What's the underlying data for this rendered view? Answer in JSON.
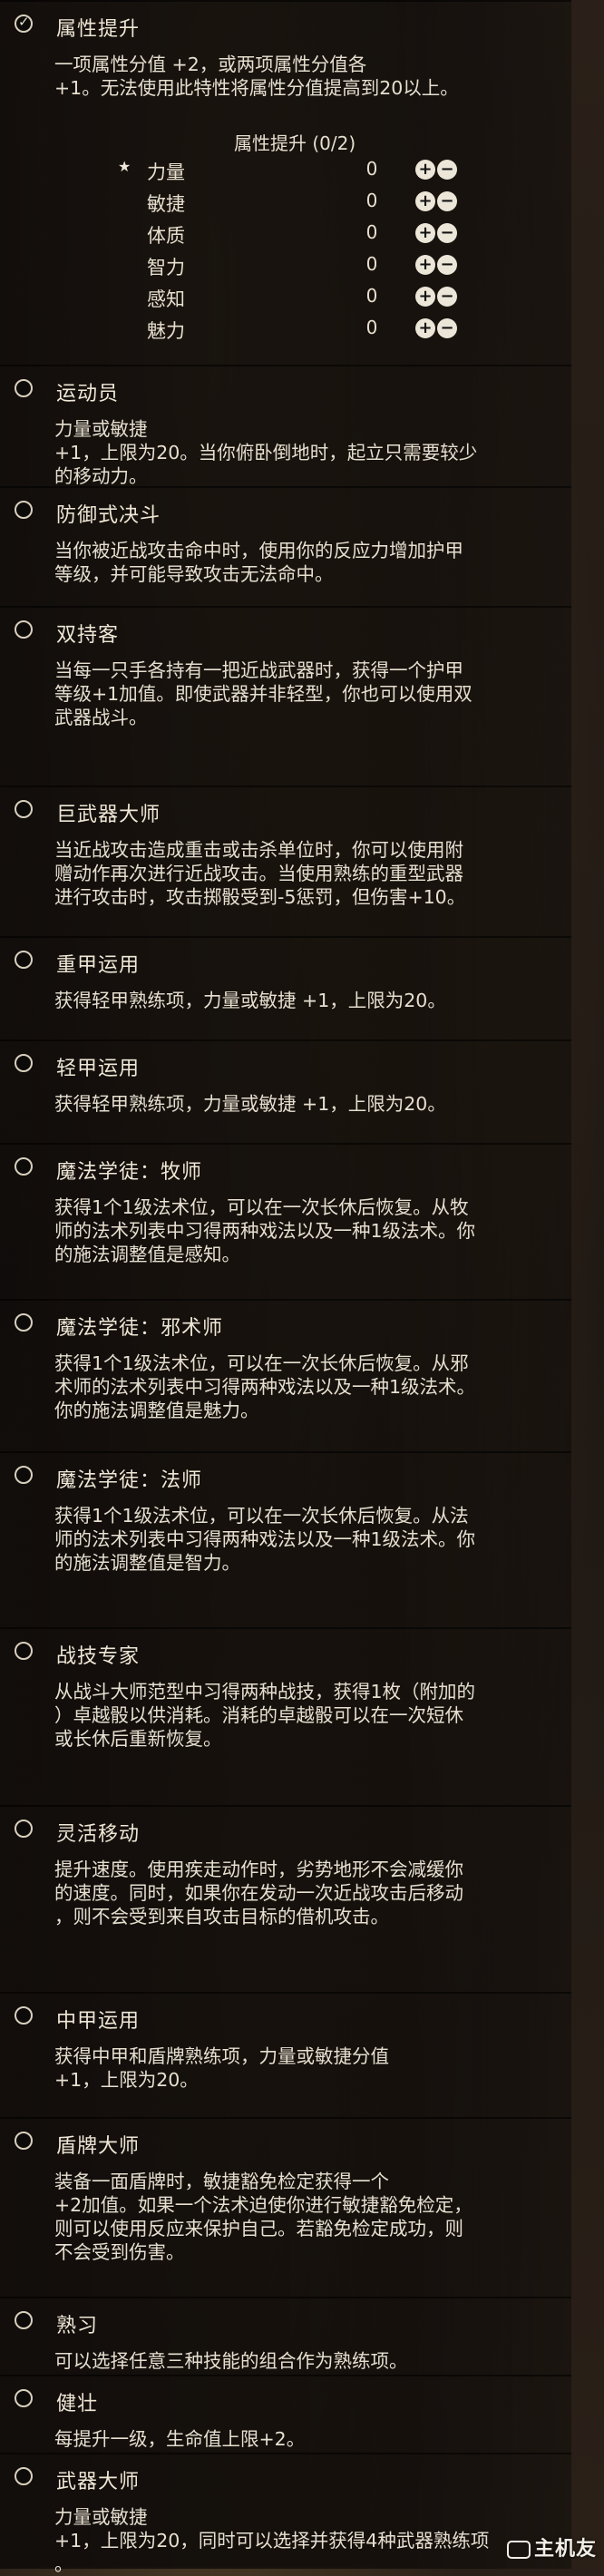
{
  "feats": [
    {
      "title": "属性提升",
      "checked": true,
      "desc": "一项属性分值 +2，或两项属性分值各\n+1。无法使用此特性将属性分值提高到20以上。"
    },
    {
      "title": "运动员",
      "checked": false,
      "desc": "力量或敏捷\n+1，上限为20。当你俯卧倒地时，起立只需要较少\n的移动力。"
    },
    {
      "title": "防御式决斗",
      "checked": false,
      "desc": "当你被近战攻击命中时，使用你的反应力增加护甲\n等级，并可能导致攻击无法命中。"
    },
    {
      "title": "双持客",
      "checked": false,
      "desc": "当每一只手各持有一把近战武器时，获得一个护甲\n等级+1加值。即使武器并非轻型，你也可以使用双\n武器战斗。"
    },
    {
      "title": "巨武器大师",
      "checked": false,
      "desc": "当近战攻击造成重击或击杀单位时，你可以使用附\n赠动作再次进行近战攻击。当使用熟练的重型武器\n进行攻击时，攻击掷骰受到-5惩罚，但伤害+10。"
    },
    {
      "title": "重甲运用",
      "checked": false,
      "desc": "获得轻甲熟练项，力量或敏捷 +1，上限为20。"
    },
    {
      "title": "轻甲运用",
      "checked": false,
      "desc": "获得轻甲熟练项，力量或敏捷 +1，上限为20。"
    },
    {
      "title": "魔法学徒：牧师",
      "checked": false,
      "desc": "获得1个1级法术位，可以在一次长休后恢复。从牧\n师的法术列表中习得两种戏法以及一种1级法术。你\n的施法调整值是感知。"
    },
    {
      "title": "魔法学徒：邪术师",
      "checked": false,
      "desc": "获得1个1级法术位，可以在一次长休后恢复。从邪\n术师的法术列表中习得两种戏法以及一种1级法术。\n你的施法调整值是魅力。"
    },
    {
      "title": "魔法学徒：法师",
      "checked": false,
      "desc": "获得1个1级法术位，可以在一次长休后恢复。从法\n师的法术列表中习得两种戏法以及一种1级法术。你\n的施法调整值是智力。"
    },
    {
      "title": "战技专家",
      "checked": false,
      "desc": "从战斗大师范型中习得两种战技，获得1枚（附加的\n）卓越骰以供消耗。消耗的卓越骰可以在一次短休\n或长休后重新恢复。"
    },
    {
      "title": "灵活移动",
      "checked": false,
      "desc": "提升速度。使用疾走动作时，劣势地形不会减缓你\n的速度。同时，如果你在发动一次近战攻击后移动\n，则不会受到来自攻击目标的借机攻击。"
    },
    {
      "title": "中甲运用",
      "checked": false,
      "desc": "获得中甲和盾牌熟练项，力量或敏捷分值\n+1，上限为20。"
    },
    {
      "title": "盾牌大师",
      "checked": false,
      "desc": "装备一面盾牌时，敏捷豁免检定获得一个\n+2加值。如果一个法术迫使你进行敏捷豁免检定，\n则可以使用反应来保护自己。若豁免检定成功，则\n不会受到伤害。"
    },
    {
      "title": "熟习",
      "checked": false,
      "desc": "可以选择任意三种技能的组合作为熟练项。"
    },
    {
      "title": "健壮",
      "checked": false,
      "desc": "每提升一级，生命值上限+2。"
    },
    {
      "title": "武器大师",
      "checked": false,
      "desc": "力量或敏捷\n+1，上限为20，同时可以选择并获得4种武器熟练项\n。"
    }
  ],
  "ability_boost": {
    "header": "属性提升 (0/2)",
    "rows": [
      {
        "name": "力量",
        "value": "0",
        "starred": true
      },
      {
        "name": "敏捷",
        "value": "0",
        "starred": false
      },
      {
        "name": "体质",
        "value": "0",
        "starred": false
      },
      {
        "name": "智力",
        "value": "0",
        "starred": false
      },
      {
        "name": "感知",
        "value": "0",
        "starred": false
      },
      {
        "name": "魅力",
        "value": "0",
        "starred": false
      }
    ],
    "star": "★",
    "plus": "+",
    "minus": "−"
  },
  "footer": {
    "logo_text": "主机友"
  }
}
